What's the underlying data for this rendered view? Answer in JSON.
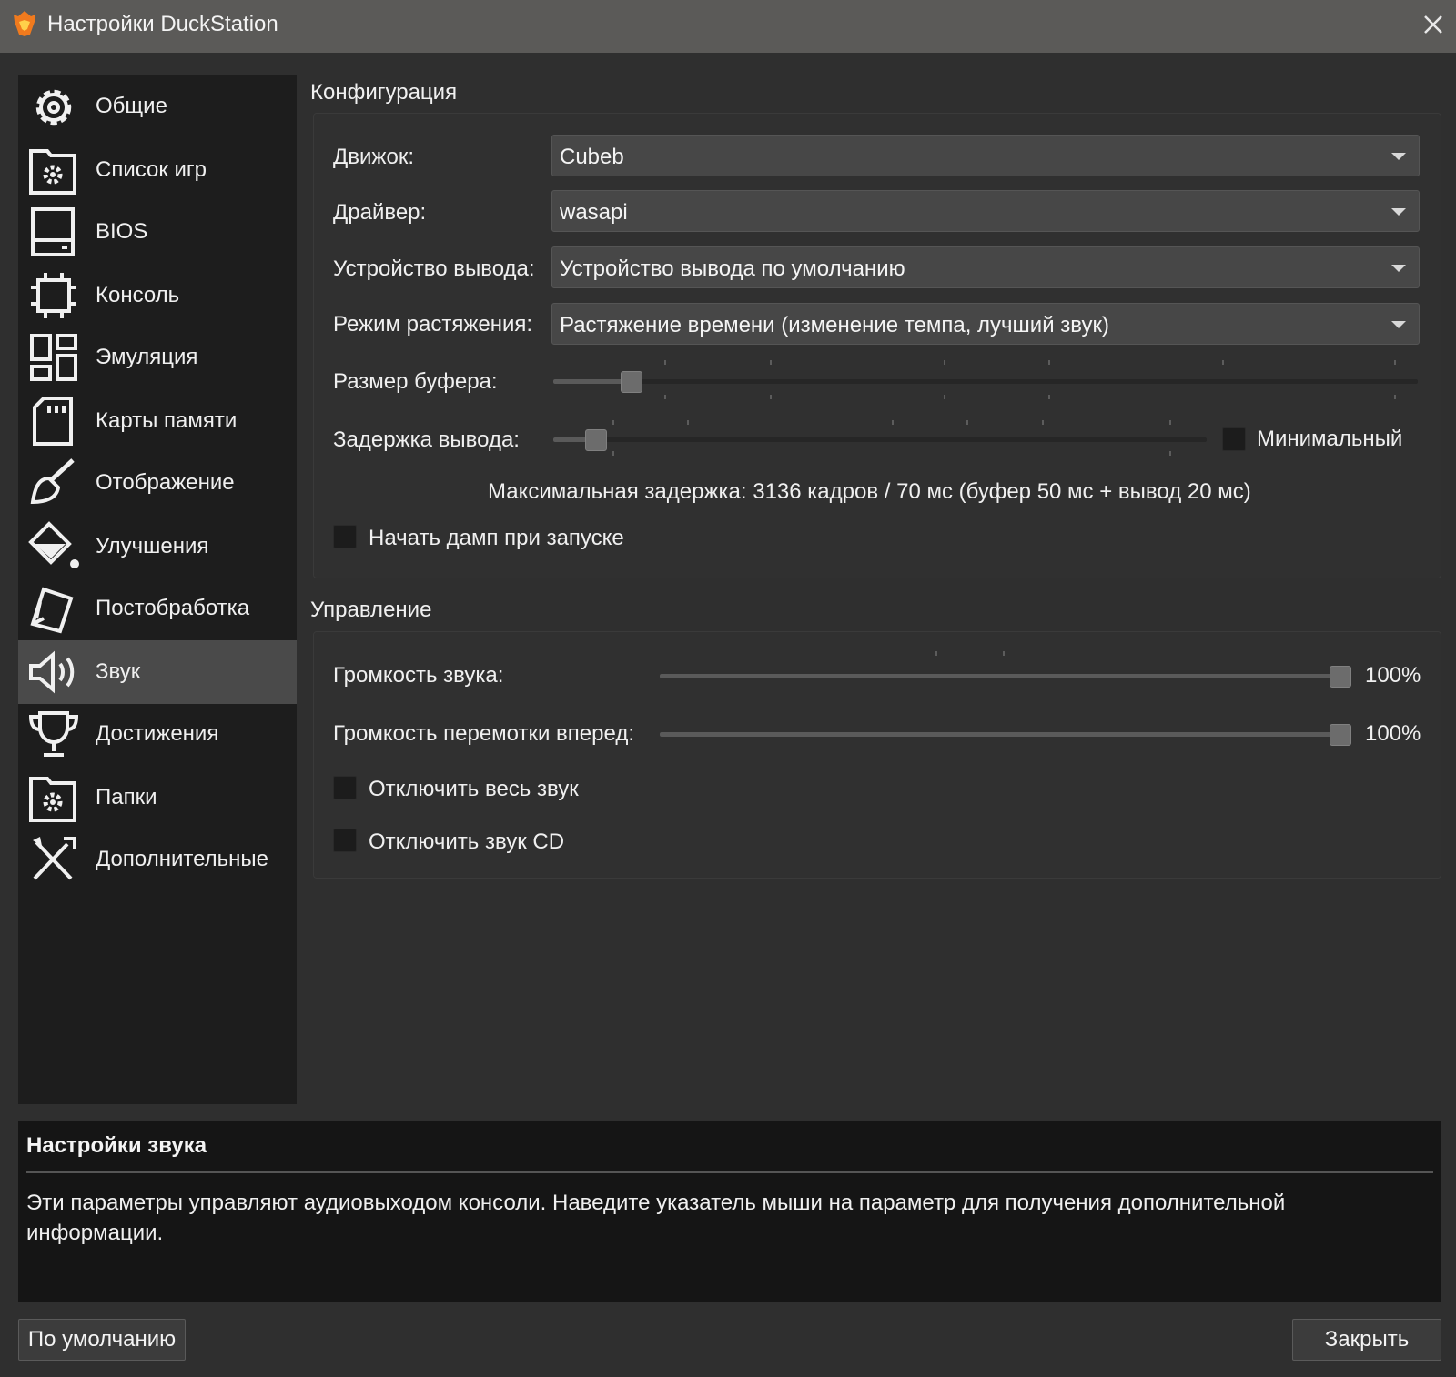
{
  "window": {
    "title": "Настройки DuckStation",
    "icon": "duckstation-logo-icon",
    "close_icon": "close-icon"
  },
  "sidebar": {
    "items": [
      {
        "label": "Общие",
        "icon": "gear-icon"
      },
      {
        "label": "Список игр",
        "icon": "folder-gear-icon"
      },
      {
        "label": "BIOS",
        "icon": "bios-chip-icon"
      },
      {
        "label": "Консоль",
        "icon": "cpu-icon"
      },
      {
        "label": "Эмуляция",
        "icon": "dashboard-icon"
      },
      {
        "label": "Карты памяти",
        "icon": "memory-card-icon"
      },
      {
        "label": "Отображение",
        "icon": "brush-icon"
      },
      {
        "label": "Улучшения",
        "icon": "paint-bucket-icon"
      },
      {
        "label": "Постобработка",
        "icon": "cards-icon"
      },
      {
        "label": "Звук",
        "icon": "speaker-icon"
      },
      {
        "label": "Достижения",
        "icon": "trophy-icon"
      },
      {
        "label": "Папки",
        "icon": "folder-settings-icon"
      },
      {
        "label": "Дополнительные",
        "icon": "tools-icon"
      }
    ],
    "active": "Звук"
  },
  "configuration": {
    "title": "Конфигурация",
    "backend": {
      "label": "Движок:",
      "value": "Cubeb"
    },
    "driver": {
      "label": "Драйвер:",
      "value": "wasapi"
    },
    "output_device": {
      "label": "Устройство вывода:",
      "value": "Устройство вывода по умолчанию"
    },
    "stretch_mode": {
      "label": "Режим растяжения:",
      "value": "Растяжение времени (изменение темпа, лучший звук)"
    },
    "buffer_size": {
      "label": "Размер буфера:",
      "position": 0.08
    },
    "output_latency": {
      "label": "Задержка вывода:",
      "position": 0.05,
      "minimal_label": "Минимальный",
      "minimal_checked": false
    },
    "max_latency_text": "Максимальная задержка: 3136 кадров / 70 мс (буфер 50 мс + вывод 20 мс)",
    "dump_on_boot": {
      "label": "Начать дамп при запуске",
      "checked": false
    }
  },
  "controls": {
    "title": "Управление",
    "volume": {
      "label": "Громкость звука:",
      "value": "100%",
      "level": 1.0
    },
    "fast_forward_volume": {
      "label": "Громкость перемотки вперед:",
      "value": "100%",
      "level": 1.0
    },
    "mute_all": {
      "label": "Отключить весь звук",
      "checked": false
    },
    "mute_cd": {
      "label": "Отключить звук CD",
      "checked": false
    }
  },
  "help": {
    "title": "Настройки звука",
    "text": "Эти параметры управляют аудиовыходом консоли. Наведите указатель мыши на параметр для получения дополнительной информации."
  },
  "buttons": {
    "defaults": "По умолчанию",
    "close": "Закрыть"
  },
  "colors": {
    "title_bar": "#5b5a58",
    "sidebar": "#1d1d1d",
    "active_item": "#4a4a4a",
    "content": "#2f2f2f",
    "help_panel": "#151515"
  }
}
